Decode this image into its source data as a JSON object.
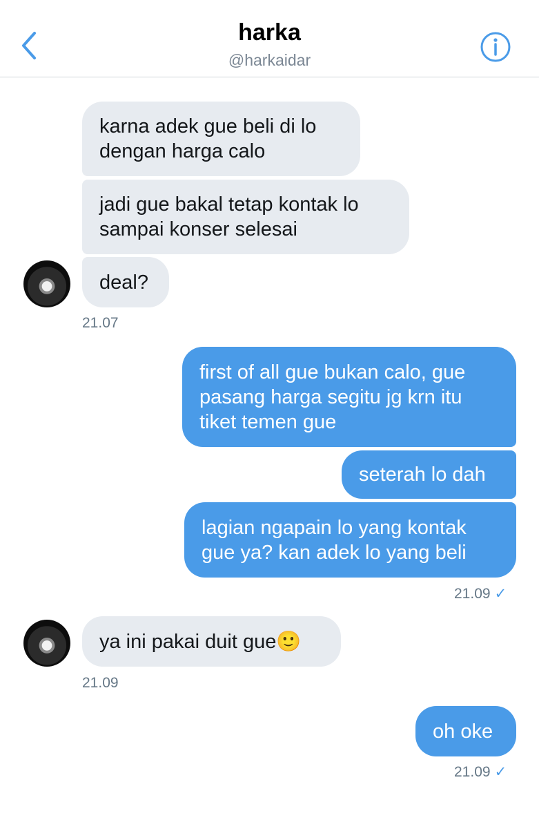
{
  "header": {
    "name": "harka",
    "handle": "@harkaidar"
  },
  "messages": {
    "m1": "karna adek gue beli di lo dengan harga calo",
    "m2": "jadi gue bakal tetap kontak lo sampai konser selesai",
    "m3": "deal?",
    "t1": "21.07",
    "m4": "first of all gue bukan calo, gue pasang harga segitu jg krn itu tiket temen gue",
    "m5": "seterah lo dah",
    "m6": "lagian ngapain lo yang kontak gue ya? kan adek lo yang beli",
    "t2": "21.09",
    "m7": "ya ini pakai duit gue🙂",
    "t3": "21.09",
    "m8": "oh oke",
    "t4": "21.09",
    "read_mark": "✓"
  },
  "colors": {
    "accent": "#4a9be8",
    "incoming_bubble": "#e7ebf0",
    "timestamp": "#657786"
  },
  "icons": {
    "back": "chevron-left-icon",
    "info": "info-icon"
  }
}
